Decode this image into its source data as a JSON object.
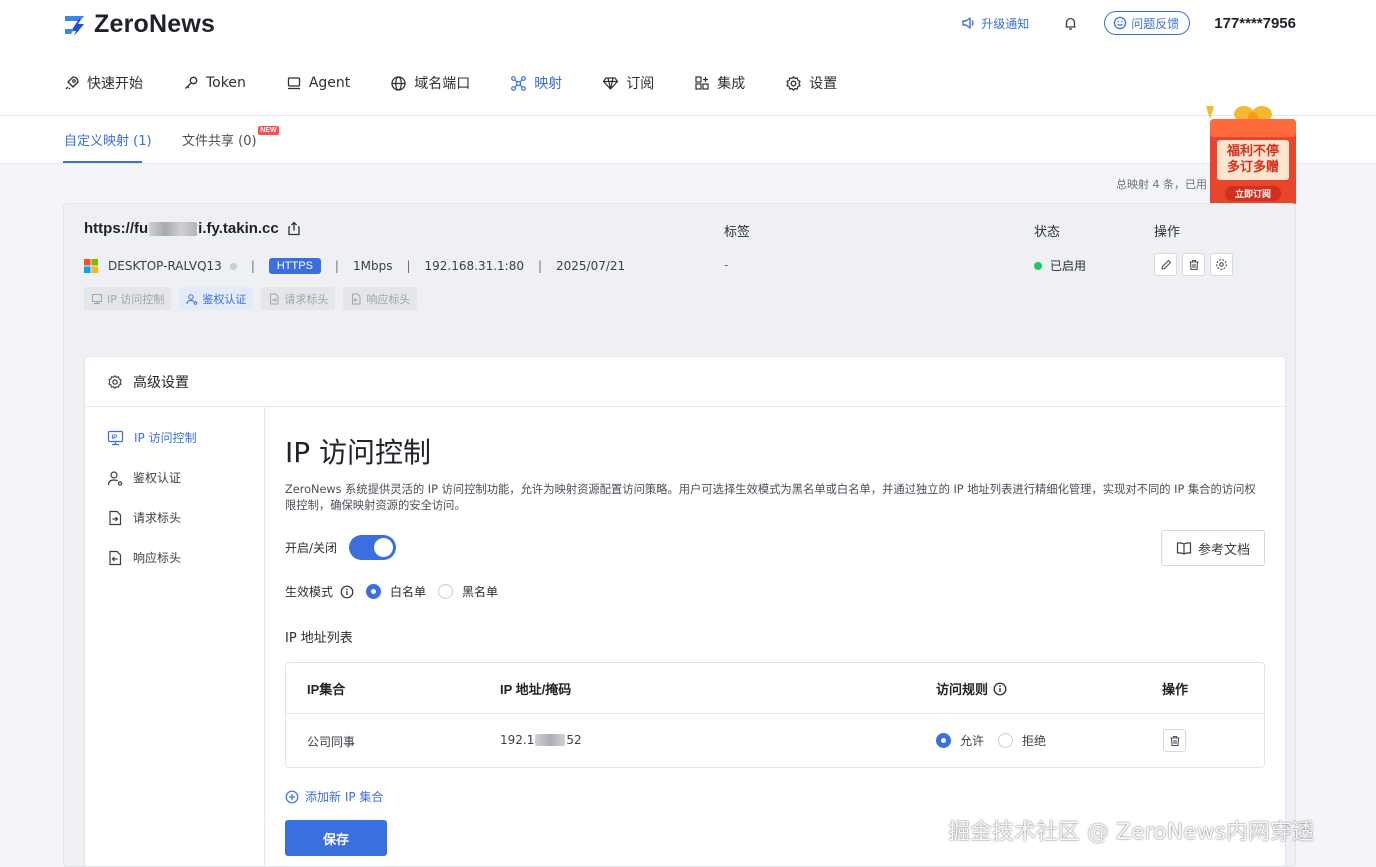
{
  "header": {
    "logo_text": "ZeroNews",
    "notify_label": "升级通知",
    "feedback_label": "问题反馈",
    "phone": "177****7956"
  },
  "nav": {
    "items": [
      {
        "label": "快速开始",
        "icon": "rocket-icon"
      },
      {
        "label": "Token",
        "icon": "key-icon"
      },
      {
        "label": "Agent",
        "icon": "monitor-icon"
      },
      {
        "label": "域名端口",
        "icon": "globe-icon"
      },
      {
        "label": "映射",
        "icon": "share-nodes-icon",
        "active": true
      },
      {
        "label": "订阅",
        "icon": "diamond-icon"
      },
      {
        "label": "集成",
        "icon": "apps-icon"
      },
      {
        "label": "设置",
        "icon": "gear-icon"
      }
    ]
  },
  "subtabs": {
    "custom": "自定义映射 (1)",
    "files": "文件共享 (0)",
    "new_badge": "NEW"
  },
  "summary": "总映射 4 条，已用",
  "promo": {
    "line1": "福利不停",
    "line2": "多订多赠",
    "cta": "立即订阅"
  },
  "mapping": {
    "url_prefix": "https://fu",
    "url_suffix": "i.fy.takin.cc",
    "col_tag": "标签",
    "col_status": "状态",
    "col_ops": "操作",
    "device": "DESKTOP-RALVQ13",
    "protocol": "HTTPS",
    "bandwidth": "1Mbps",
    "target": "192.168.31.1:80",
    "date": "2025/07/21",
    "tag": "-",
    "status": "已启用",
    "chips": [
      "IP 访问控制",
      "鉴权认证",
      "请求标头",
      "响应标头"
    ]
  },
  "advanced": {
    "title": "高级设置",
    "side": [
      "IP 访问控制",
      "鉴权认证",
      "请求标头",
      "响应标头"
    ],
    "content_title": "IP 访问控制",
    "description": "ZeroNews 系统提供灵活的 IP 访问控制功能，允许为映射资源配置访问策略。用户可选择生效模式为黑名单或白名单，并通过独立的 IP 地址列表进行精细化管理，实现对不同的 IP 集合的访问权限控制，确保映射资源的安全访问。",
    "toggle_label": "开启/关闭",
    "toggle_on": true,
    "doc_button": "参考文档",
    "mode_label": "生效模式",
    "mode_white": "白名单",
    "mode_black": "黑名单",
    "mode_selected": "白名单",
    "ip_list_label": "IP 地址列表",
    "table": {
      "headers": [
        "IP集合",
        "IP 地址/掩码",
        "访问规则",
        "操作"
      ],
      "rows": [
        {
          "set": "公司同事",
          "ip_prefix": "192.1",
          "ip_suffix": "52",
          "allow": "允许",
          "deny": "拒绝",
          "rule": "允许"
        }
      ]
    },
    "add_label": "添加新 IP 集合",
    "save_label": "保存"
  },
  "watermark": "掘金技术社区 @ ZeroNews内网穿透",
  "colors": {
    "accent": "#3b6fe0",
    "status_green": "#22c55e"
  }
}
